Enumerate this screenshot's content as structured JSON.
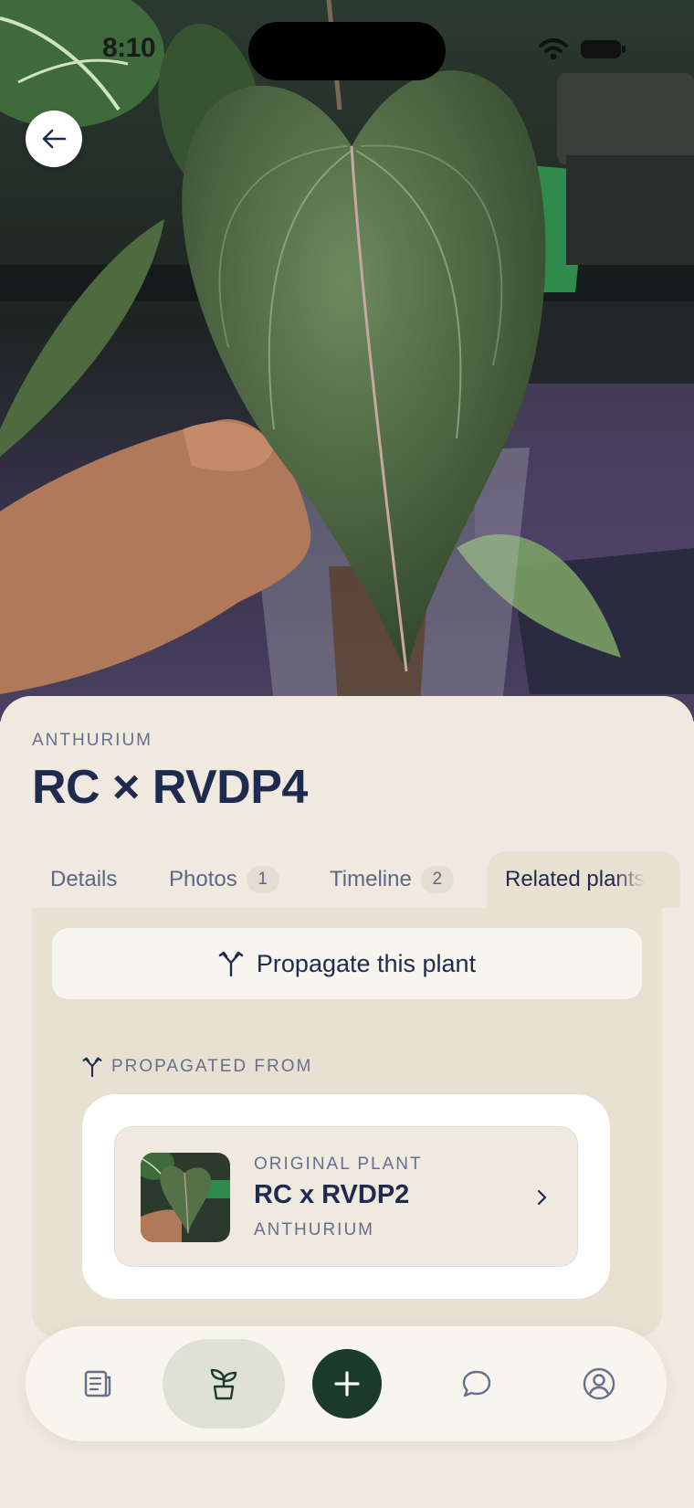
{
  "status_bar": {
    "time": "8:10"
  },
  "plant": {
    "genus": "ANTHURIUM",
    "name": "RC × RVDP4"
  },
  "tabs": [
    {
      "label": "Details"
    },
    {
      "label": "Photos",
      "count": "1"
    },
    {
      "label": "Timeline",
      "count": "2"
    },
    {
      "label": "Related plants",
      "active": true
    }
  ],
  "actions": {
    "propagate_label": "Propagate this plant"
  },
  "propagated_from": {
    "section_label": "PROPAGATED FROM",
    "kicker": "ORIGINAL PLANT",
    "name": "RC x RVDP2",
    "genus": "ANTHURIUM"
  },
  "bottom_nav": {
    "items": [
      "journal-icon",
      "plant-sprout-icon",
      "add-icon",
      "chat-bubble-icon",
      "profile-icon"
    ],
    "active": "plant-sprout-icon"
  },
  "colors": {
    "accent_dark_green": "#1c3a2a",
    "title_navy": "#1e2a4f",
    "sheet_bg": "#efe9df",
    "panel_bg": "#e8e0d0"
  }
}
